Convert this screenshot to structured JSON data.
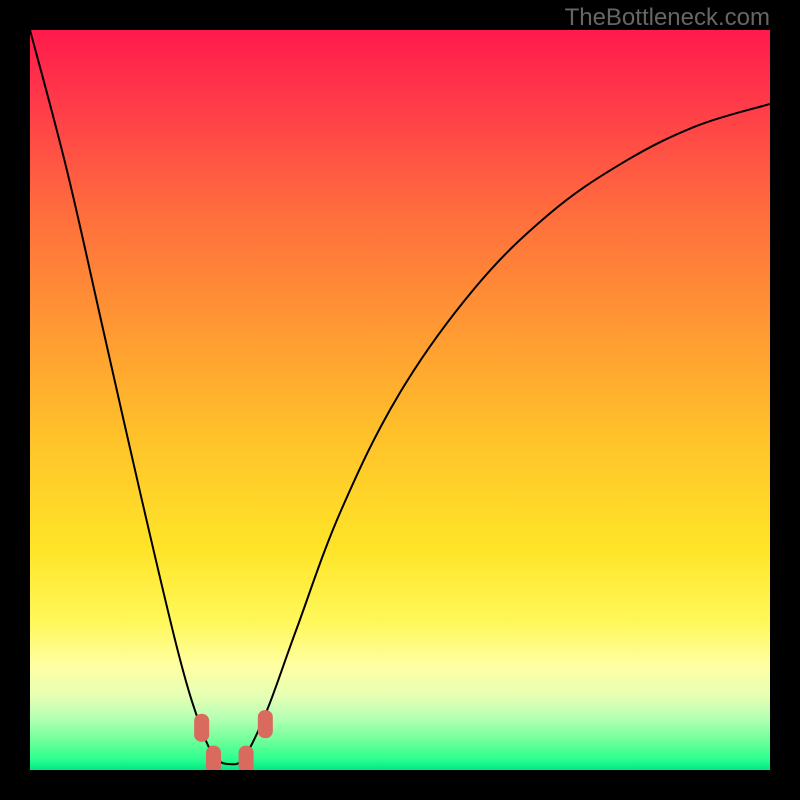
{
  "watermark": "TheBottleneck.com",
  "colors": {
    "black": "#000000",
    "gradient_stops": [
      {
        "offset": 0.0,
        "color": "#ff1a4c"
      },
      {
        "offset": 0.1,
        "color": "#ff3b49"
      },
      {
        "offset": 0.25,
        "color": "#ff6e3d"
      },
      {
        "offset": 0.4,
        "color": "#ff9833"
      },
      {
        "offset": 0.55,
        "color": "#ffc22a"
      },
      {
        "offset": 0.7,
        "color": "#ffe428"
      },
      {
        "offset": 0.8,
        "color": "#fff85a"
      },
      {
        "offset": 0.86,
        "color": "#ffffa4"
      },
      {
        "offset": 0.9,
        "color": "#e6ffb4"
      },
      {
        "offset": 0.93,
        "color": "#b4ffb4"
      },
      {
        "offset": 0.96,
        "color": "#70ff9a"
      },
      {
        "offset": 0.985,
        "color": "#2cff8e"
      },
      {
        "offset": 1.0,
        "color": "#00e886"
      }
    ],
    "marker": "#d86a5e",
    "curve": "#000000"
  },
  "chart_data": {
    "type": "line",
    "title": "",
    "xlabel": "",
    "ylabel": "",
    "xlim": [
      0,
      1
    ],
    "ylim": [
      0,
      1
    ],
    "note": "Bottleneck-style V-curve. Minimum located near x≈0.27. Values are fractional pixel positions read off the 740×740 plot area (y=0 bottom, y=1 top).",
    "series": [
      {
        "name": "bottleneck-curve",
        "x": [
          0.0,
          0.05,
          0.1,
          0.15,
          0.2,
          0.23,
          0.25,
          0.27,
          0.29,
          0.32,
          0.36,
          0.42,
          0.5,
          0.6,
          0.7,
          0.8,
          0.9,
          1.0
        ],
        "y": [
          1.0,
          0.81,
          0.59,
          0.37,
          0.16,
          0.06,
          0.018,
          0.008,
          0.018,
          0.08,
          0.19,
          0.35,
          0.51,
          0.65,
          0.75,
          0.82,
          0.87,
          0.9
        ]
      }
    ],
    "markers": {
      "name": "threshold-markers",
      "points": [
        {
          "x": 0.232,
          "y": 0.057
        },
        {
          "x": 0.248,
          "y": 0.014
        },
        {
          "x": 0.292,
          "y": 0.014
        },
        {
          "x": 0.318,
          "y": 0.062
        }
      ]
    }
  }
}
